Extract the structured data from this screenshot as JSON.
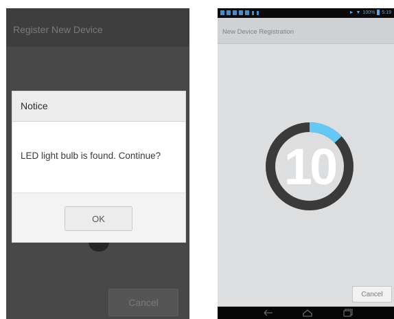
{
  "left_screen": {
    "title": "Register New Device",
    "cancel_label": "Cancel",
    "dialog": {
      "title": "Notice",
      "message": "LED light bulb is found. Continue?",
      "ok_label": "OK"
    }
  },
  "right_screen": {
    "status_bar": {
      "battery_text": "100%",
      "time": "5:19"
    },
    "title": "New Device Registration",
    "countdown": "10",
    "progress_fraction": 0.13,
    "cancel_label": "Cancel",
    "colors": {
      "ring_track": "#3a3a3a",
      "ring_progress": "#62c9f4"
    },
    "nav_icons": [
      "back-icon",
      "home-icon",
      "recent-apps-icon"
    ]
  }
}
